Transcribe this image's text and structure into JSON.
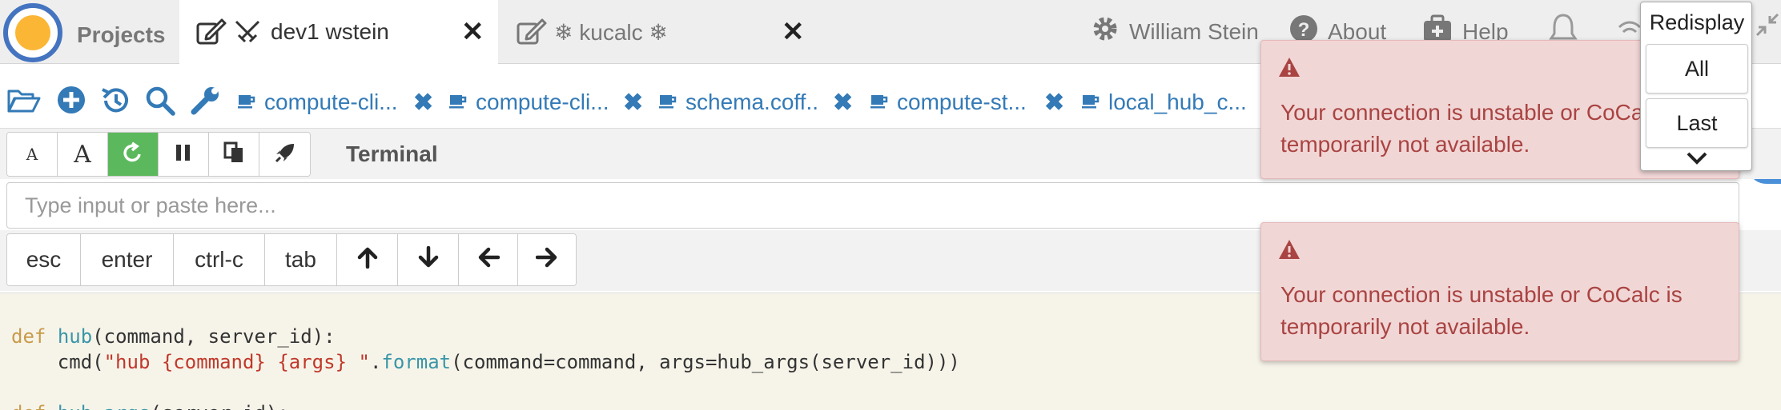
{
  "navbar": {
    "projects_label": "Projects",
    "project_tabs": [
      {
        "label": "dev1 wstein",
        "icon": "swords-icon",
        "active": true
      },
      {
        "label": "❄ kucalc ❄",
        "active": false
      }
    ],
    "user_label": "William Stein",
    "about_label": "About",
    "help_label": "Help"
  },
  "file_tabs": [
    {
      "label": "compute-cli..."
    },
    {
      "label": "compute-cli..."
    },
    {
      "label": "schema.coff.."
    },
    {
      "label": "compute-st..."
    },
    {
      "label": "local_hub_c..."
    }
  ],
  "toolbar": {
    "font_small_label": "A",
    "font_large_label": "A",
    "terminal_title": "Terminal"
  },
  "input": {
    "placeholder": "Type input or paste here...",
    "value": ""
  },
  "keys": {
    "esc": "esc",
    "enter": "enter",
    "ctrl_c": "ctrl-c",
    "tab": "tab"
  },
  "terminal": {
    "line1": {
      "kw": "def",
      "fn": "hub",
      "rest": "(command, server_id):"
    },
    "line2": {
      "pre": "    cmd(",
      "str": "\"hub {command} {args} \"",
      "dot": ".",
      "fn": "format",
      "rest": "(command=command, args=hub_args(server_id)))"
    },
    "line4": {
      "kw": "def",
      "fn": "hub_args",
      "rest": "(server_id):"
    }
  },
  "notifications": [
    {
      "message": "Your connection is unstable or CoCalc is temporarily not available."
    },
    {
      "message": "Your connection is unstable or CoCalc is temporarily not available."
    }
  ],
  "redisplay": {
    "title": "Redisplay",
    "all_label": "All",
    "last_label": "Last"
  },
  "colors": {
    "link_blue": "#337ab7",
    "success_green": "#5cb85c",
    "danger_text": "#a94442",
    "danger_bg": "#f1d6d6"
  }
}
